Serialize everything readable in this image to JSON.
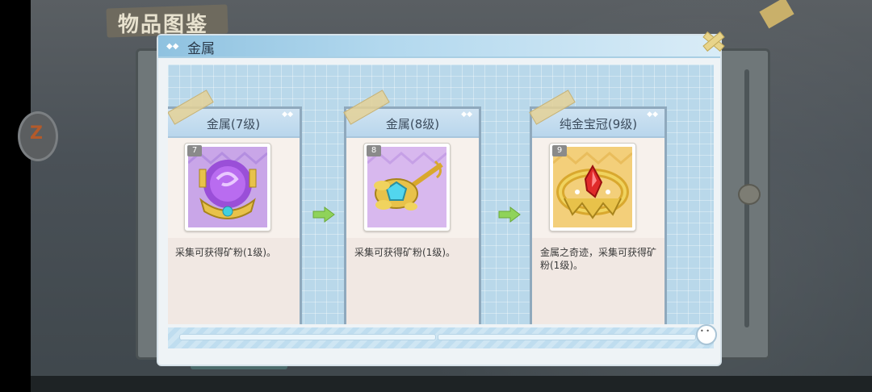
{
  "background": {
    "title": "物品图鉴"
  },
  "modal": {
    "title": "金属"
  },
  "cards": [
    {
      "title": "金属(7级)",
      "level": "7",
      "description": "采集可获得矿粉(1级)。",
      "item_icon": "purple-orb-crown-icon"
    },
    {
      "title": "金属(8级)",
      "level": "8",
      "description": "采集可获得矿粉(1级)。",
      "item_icon": "jeweled-scepter-icon"
    },
    {
      "title": "纯金宝冠(9级)",
      "level": "9",
      "description": "金属之奇迹，采集可获得矿粉(1级)。",
      "item_icon": "golden-crown-red-gem-icon"
    }
  ],
  "colors": {
    "header_blue": "#8fc2e0",
    "card_border": "#8fa9bd",
    "arrow_green": "#8fd35a"
  }
}
